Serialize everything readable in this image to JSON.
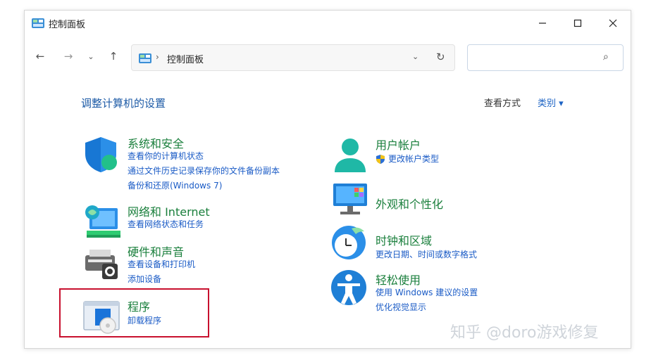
{
  "window": {
    "title": "控制面板"
  },
  "nav": {
    "back": "←",
    "forward": "→",
    "recent": "⌄",
    "up": "↑"
  },
  "address": {
    "separator": "›",
    "path": "控制面板",
    "dropdown": "⌄",
    "refresh": "↻"
  },
  "search": {
    "placeholder": "",
    "icon": "⌕"
  },
  "content": {
    "title": "调整计算机的设置",
    "view_by_label": "查看方式",
    "view_by_value": "类别 ▾"
  },
  "categories": [
    {
      "title": "系统和安全",
      "links": [
        "查看你的计算机状态",
        "通过文件历史记录保存你的文件备份副本",
        "备份和还原(Windows 7)"
      ],
      "icon": "shield-icon"
    },
    {
      "title": "网络和 Internet",
      "links": [
        "查看网络状态和任务"
      ],
      "icon": "network-icon"
    },
    {
      "title": "硬件和声音",
      "links": [
        "查看设备和打印机",
        "添加设备"
      ],
      "icon": "printer-icon"
    },
    {
      "title": "程序",
      "links": [
        "卸载程序"
      ],
      "icon": "programs-icon"
    },
    {
      "title": "用户帐户",
      "links": [
        "更改帐户类型"
      ],
      "icon": "user-icon"
    },
    {
      "title": "外观和个性化",
      "links": [],
      "icon": "monitor-icon"
    },
    {
      "title": "时钟和区域",
      "links": [
        "更改日期、时间或数字格式"
      ],
      "icon": "clock-icon"
    },
    {
      "title": "轻松使用",
      "links": [
        "使用 Windows 建议的设置",
        "优化视觉显示"
      ],
      "icon": "accessibility-icon"
    }
  ],
  "watermark": "知乎 @doro游戏修复",
  "colors": {
    "link": "#1a5bc6",
    "category_title": "#1a7f3c",
    "highlight": "#c8102e",
    "page_title": "#1c5aa6"
  }
}
